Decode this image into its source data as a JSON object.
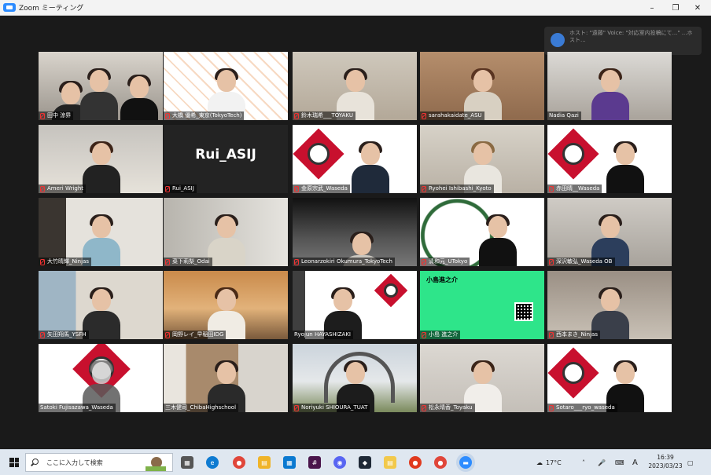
{
  "window": {
    "title": "Zoom ミーティング"
  },
  "notification": {
    "text": "ホスト: \"遠藤\" Voice: \"対応室内投稿にて...\" ...ホスト..."
  },
  "participants": [
    {
      "name": "田中 涼界",
      "muted": true
    },
    {
      "name": "大橋 優希_東京(TokyoTech)",
      "muted": true
    },
    {
      "name": "鈴木瑞希___TOYAKU",
      "muted": true
    },
    {
      "name": "sarahakaidate_ASU",
      "muted": true
    },
    {
      "name": "Nadia Qazi",
      "muted": false
    },
    {
      "name": "Ameri Wright",
      "muted": true
    },
    {
      "name": "Rui_ASIJ",
      "muted": true,
      "display_name": "Rui_ASIJ"
    },
    {
      "name": "金原宗武_Waseda",
      "muted": true
    },
    {
      "name": "Ryohei Ishibashi_Kyoto",
      "muted": true
    },
    {
      "name": "赤田晴__Waseda",
      "muted": true
    },
    {
      "name": "大竹晴輝_Ninjas",
      "muted": true
    },
    {
      "name": "菜下莉梨_Odai",
      "muted": true
    },
    {
      "name": "Leonarzokiri Okumura_TokyoTech",
      "muted": true
    },
    {
      "name": "清和元_UTokyo",
      "muted": true
    },
    {
      "name": "深沢敏弘_Waseda OB",
      "muted": true
    },
    {
      "name": "矢田翔馬_YSFH",
      "muted": true
    },
    {
      "name": "岡野レイ_早稲田IDG",
      "muted": true
    },
    {
      "name": "Ryojun HAYASHIZAKI",
      "muted": false
    },
    {
      "name": "小島 進之介",
      "muted": true,
      "card_title": "小島進之介"
    },
    {
      "name": "西本まき_Ninjas",
      "muted": true
    },
    {
      "name": "Satoki Fujisazawa_Waseda",
      "muted": true
    },
    {
      "name": "三木健司_ChibaHighschool",
      "muted": false
    },
    {
      "name": "Noriyuki SHIOURA_TUAT",
      "muted": true
    },
    {
      "name": "松永晴香_Toyaku",
      "muted": true
    },
    {
      "name": "Sotaro___ryo_waseda",
      "muted": true
    }
  ],
  "taskbar": {
    "search_placeholder": "ここに入力して検索",
    "weather": "17°C",
    "ime": "A",
    "time": "16:39",
    "date": "2023/03/23"
  }
}
